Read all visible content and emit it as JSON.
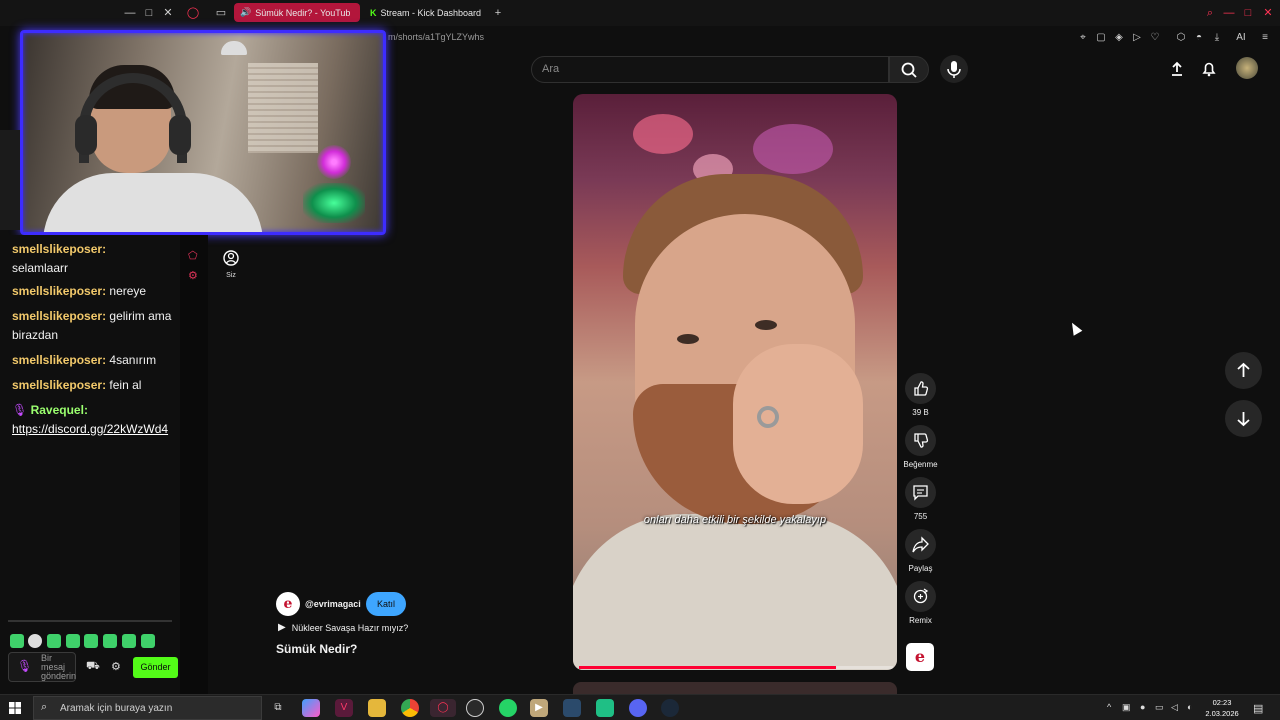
{
  "browser": {
    "tabs": [
      {
        "title": "Sümük Nedir? - YouTub",
        "active": true
      },
      {
        "title": "Stream - Kick Dashboard",
        "active": false
      }
    ],
    "new_tab": "+",
    "url_fragment": "m/shorts/a1TgYLZYwhs",
    "ai_label": "AI"
  },
  "youtube": {
    "search_placeholder": "Ara",
    "sidebar_you_label": "Siz",
    "subtitle": "onları daha etkili bir şekilde yakalayıp",
    "actions": {
      "like_count": "39 B",
      "dislike_label": "Beğenme",
      "comments_count": "755",
      "share_label": "Paylaş",
      "remix_label": "Remix"
    },
    "channel": {
      "handle": "@evrimagaci",
      "join_label": "Katıl",
      "logo_letter": "e"
    },
    "playlist_title": "Nükleer Savaşa Hazır mıyız?",
    "short_title": "Sümük Nedir?",
    "progress_fraction": 0.82
  },
  "chat": {
    "messages": [
      {
        "user": "smellslikeposer",
        "text": "selamlaarr"
      },
      {
        "user": "smellslikeposer",
        "text": "nereye"
      },
      {
        "user": "smellslikeposer",
        "text": "gelirim ama birazdan"
      },
      {
        "user": "smellslikeposer",
        "text": "4sanırım"
      },
      {
        "user": "smellslikeposer",
        "text": "fein al"
      },
      {
        "user": "Ravequel",
        "text": "https://discord.gg/22kWzWd4"
      }
    ],
    "input_placeholder": "Bir mesaj gönderin",
    "send_label": "Gönder"
  },
  "taskbar": {
    "search_placeholder": "Aramak için buraya yazın",
    "time": "02:23",
    "date": "2.03.2026"
  },
  "colors": {
    "kick_green": "#53fc18",
    "youtube_red": "#ff0033",
    "join_blue": "#3ea6ff",
    "tab_active": "#b3163b",
    "cam_border": "#3d2cff"
  }
}
